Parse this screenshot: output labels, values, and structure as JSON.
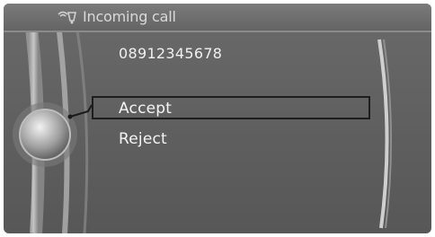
{
  "header": {
    "icon": "phone-signal-icon",
    "title": "Incoming call"
  },
  "call": {
    "number": "08912345678"
  },
  "menu": {
    "items": [
      {
        "label": "Accept",
        "selected": true
      },
      {
        "label": "Reject",
        "selected": false
      }
    ]
  },
  "colors": {
    "background": "#616161",
    "text": "#f0f0f0",
    "selection_border": "#1e1e1e"
  }
}
